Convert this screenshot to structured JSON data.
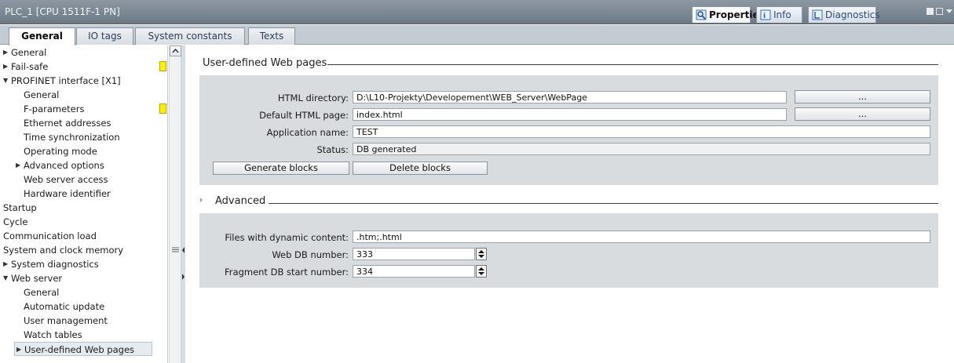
{
  "window": {
    "title": "PLC_1 [CPU 1511F-1 PN]",
    "tabs": [
      {
        "label": "Properties",
        "icon": "properties-icon"
      },
      {
        "label": "Info",
        "icon": "info-icon"
      },
      {
        "label": "Diagnostics",
        "icon": "diagnostics-icon"
      }
    ]
  },
  "subtabs": [
    "General",
    "IO tags",
    "System constants",
    "Texts"
  ],
  "nav": {
    "items": [
      {
        "label": "General",
        "arrow": "▶"
      },
      {
        "label": "Fail-safe",
        "arrow": "▶"
      },
      {
        "label": "PROFINET interface [X1]",
        "arrow": "▼"
      },
      {
        "label": "General"
      },
      {
        "label": "F-parameters"
      },
      {
        "label": "Ethernet addresses"
      },
      {
        "label": "Time synchronization"
      },
      {
        "label": "Operating mode"
      },
      {
        "label": "Advanced options",
        "arrow": "▶"
      },
      {
        "label": "Web server access"
      },
      {
        "label": "Hardware identifier"
      },
      {
        "label": "Startup"
      },
      {
        "label": "Cycle"
      },
      {
        "label": "Communication load"
      },
      {
        "label": "System and clock memory"
      },
      {
        "label": "System diagnostics",
        "arrow": "▶"
      },
      {
        "label": "Web server",
        "arrow": "▼"
      },
      {
        "label": "General"
      },
      {
        "label": "Automatic update"
      },
      {
        "label": "User management"
      },
      {
        "label": "Watch tables"
      },
      {
        "label": "User-defined Web pages",
        "arrow": "▶"
      }
    ]
  },
  "udwp": {
    "title": "User-defined Web pages",
    "html_dir_label": "HTML directory:",
    "html_dir_value": "D:\\L10-Projekty\\Developement\\WEB_Server\\WebPage",
    "default_page_label": "Default HTML page:",
    "default_page_value": "index.html",
    "app_name_label": "Application name:",
    "app_name_value": "TEST",
    "status_label": "Status:",
    "status_value": "DB generated",
    "browse_label": "...",
    "generate_label": "Generate blocks",
    "delete_label": "Delete blocks"
  },
  "advanced": {
    "title": "Advanced",
    "arrow": "›",
    "dyn_label": "Files with dynamic content:",
    "dyn_value": ".htm;.html",
    "webdb_label": "Web DB number:",
    "webdb_value": "333",
    "frag_label": "Fragment DB start number:",
    "frag_value": "334"
  }
}
